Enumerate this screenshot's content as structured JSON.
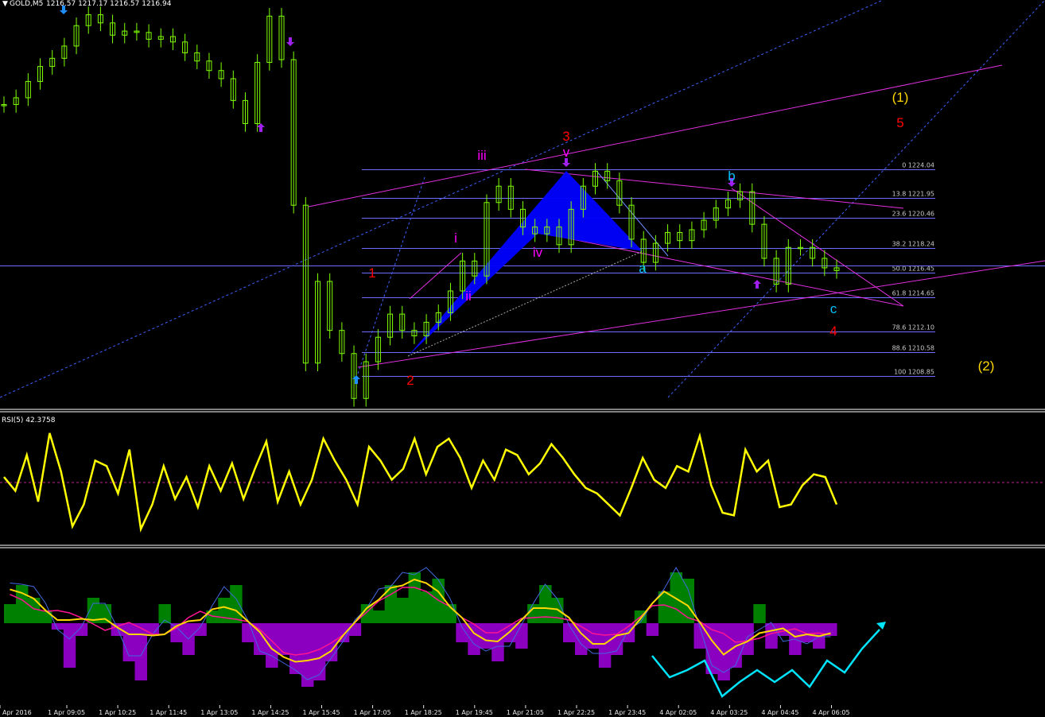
{
  "header": {
    "symbol": "GOLD,M5",
    "ohlc": "1216.57 1217.17 1216.57 1216.94",
    "rsi": "RSI(5) 42.3758"
  },
  "colors": {
    "background": "#000000",
    "candles": "#7fff00",
    "fib": "#6d6dff",
    "channel": "#e030e0",
    "harmonic": "#0000ff",
    "rsi": "#ffff00",
    "hist_pos": "#008000",
    "hist_neg": "#8b00c0",
    "forecast": "#00e5ff"
  },
  "fib_levels": [
    {
      "label": "0 1224.04"
    },
    {
      "label": "13.8 1221.95"
    },
    {
      "label": "23.6 1220.46"
    },
    {
      "label": "38.2 1218.24"
    },
    {
      "label": "50.0 1216.45"
    },
    {
      "label": "61.8 1214.65"
    },
    {
      "label": "78.6 1212.10"
    },
    {
      "label": "88.6 1210.58"
    },
    {
      "label": "100 1208.85"
    }
  ],
  "wave_labels": [
    {
      "text": "1",
      "color": "#ff0000"
    },
    {
      "text": "2",
      "color": "#ff0000"
    },
    {
      "text": "3",
      "color": "#ff0000"
    },
    {
      "text": "4",
      "color": "#ff0000"
    },
    {
      "text": "5",
      "color": "#ff0000"
    },
    {
      "text": "i",
      "color": "#ff00ff"
    },
    {
      "text": "ii",
      "color": "#ff00ff"
    },
    {
      "text": "iii",
      "color": "#ff00ff"
    },
    {
      "text": "iv",
      "color": "#ff00ff"
    },
    {
      "text": "v",
      "color": "#ff00ff"
    },
    {
      "text": "a",
      "color": "#00bfff"
    },
    {
      "text": "b",
      "color": "#00bfff"
    },
    {
      "text": "c",
      "color": "#00bfff"
    },
    {
      "text": "(1)",
      "color": "#ffd700"
    },
    {
      "text": "(2)",
      "color": "#ffd700"
    }
  ],
  "time_labels": [
    "Apr 2016",
    "1 Apr 09:05",
    "1 Apr 10:25",
    "1 Apr 11:45",
    "1 Apr 13:05",
    "1 Apr 14:25",
    "1 Apr 15:45",
    "1 Apr 17:05",
    "1 Apr 18:25",
    "1 Apr 19:45",
    "1 Apr 21:05",
    "1 Apr 22:25",
    "1 Apr 23:45",
    "4 Apr 02:05",
    "4 Apr 03:25",
    "4 Apr 04:45",
    "4 Apr 06:05"
  ],
  "chart_data": {
    "type": "line",
    "instrument": "GOLD",
    "timeframe": "M5",
    "price_axis_levels": [
      1224.04,
      1221.95,
      1220.46,
      1218.24,
      1216.45,
      1214.65,
      1212.1,
      1210.58,
      1208.85
    ],
    "price_series": [
      1228.8,
      1229.3,
      1230.5,
      1231.6,
      1232.2,
      1233.1,
      1234.6,
      1235.4,
      1234.8,
      1233.9,
      1234.2,
      1234.1,
      1233.6,
      1233.8,
      1233.4,
      1232.6,
      1232.0,
      1231.3,
      1230.7,
      1229.1,
      1227.4,
      1231.9,
      1235.3,
      1232.1,
      1221.4,
      1209.8,
      1215.8,
      1212.2,
      1210.5,
      1207.2,
      1209.9,
      1211.7,
      1213.4,
      1212.2,
      1211.8,
      1212.8,
      1213.5,
      1215.1,
      1217.3,
      1216.2,
      1221.6,
      1222.8,
      1221.1,
      1219.8,
      1219.3,
      1219.8,
      1218.5,
      1221.1,
      1222.8,
      1223.9,
      1223.2,
      1221.4,
      1218.9,
      1217.2,
      1218.6,
      1219.4,
      1218.8,
      1219.6,
      1220.3,
      1221.2,
      1221.8,
      1222.4,
      1220.0,
      1217.5,
      1215.6,
      1218.3,
      1218.3,
      1217.5,
      1216.8,
      1216.6
    ],
    "rsi_series": [
      52,
      47,
      60,
      43,
      68,
      54,
      34,
      42,
      58,
      56,
      46,
      62,
      33,
      42,
      56,
      44,
      52,
      41,
      56,
      47,
      57,
      44,
      55,
      65,
      43,
      54,
      42,
      51,
      66,
      58,
      51,
      42,
      63,
      58,
      51,
      55,
      66,
      53,
      63,
      66,
      59,
      48,
      58,
      51,
      62,
      60,
      53,
      57,
      64,
      59,
      53,
      48,
      46,
      42,
      38,
      48,
      59,
      51,
      48,
      56,
      54,
      67,
      49,
      39,
      38,
      62,
      54,
      58,
      41,
      42,
      49,
      53,
      52,
      42
    ],
    "rsi_reference": 50,
    "osc_hist": [
      0.3,
      0.6,
      0.4,
      0.2,
      -0.1,
      -0.7,
      -0.2,
      0.4,
      0.3,
      -0.2,
      -0.6,
      -0.9,
      -0.2,
      0.3,
      -0.3,
      -0.5,
      -0.2,
      0.2,
      0.4,
      0.6,
      -0.3,
      -0.5,
      -0.7,
      -0.5,
      -0.8,
      -1.0,
      -0.9,
      -0.6,
      -0.3,
      -0.2,
      0.3,
      0.2,
      0.6,
      0.4,
      0.8,
      0.5,
      0.7,
      0.3,
      -0.3,
      -0.5,
      -0.4,
      -0.6,
      -0.3,
      -0.4,
      0.3,
      0.6,
      0.4,
      -0.3,
      -0.5,
      -0.4,
      -0.7,
      -0.5,
      -0.3,
      0.2,
      -0.2,
      0.5,
      0.8,
      0.7,
      -0.4,
      -0.8,
      -0.9,
      -0.7,
      -0.5,
      0.3,
      -0.4,
      -0.2,
      -0.5,
      -0.3,
      -0.4,
      -0.2
    ],
    "forecast_path": [
      [
        0,
        0
      ],
      [
        1,
        -0.45
      ],
      [
        2,
        -0.3
      ],
      [
        3,
        -0.1
      ],
      [
        4,
        -0.85
      ],
      [
        5,
        -0.55
      ],
      [
        6,
        -0.3
      ],
      [
        7,
        -0.55
      ],
      [
        8,
        -0.3
      ],
      [
        9,
        -0.65
      ],
      [
        10,
        -0.1
      ],
      [
        11,
        -0.35
      ],
      [
        12,
        0.15
      ],
      [
        13,
        0.55
      ]
    ]
  }
}
